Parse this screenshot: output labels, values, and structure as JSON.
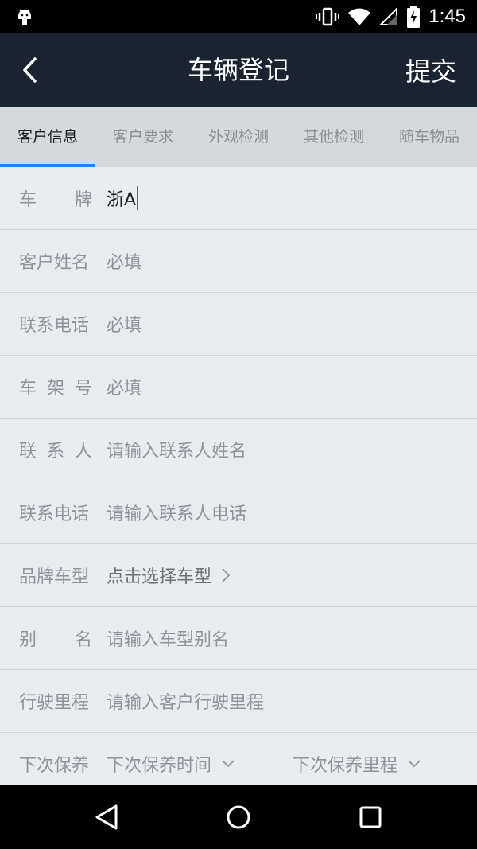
{
  "status_bar": {
    "time": "1:45",
    "icons": [
      "android-icon",
      "vibrate-icon",
      "wifi-icon",
      "signal-icon",
      "battery-charging-icon"
    ]
  },
  "app_bar": {
    "title": "车辆登记",
    "submit_label": "提交",
    "back_icon": "chevron-left-icon"
  },
  "tabs": [
    {
      "label": "客户信息",
      "active": true
    },
    {
      "label": "客户要求",
      "active": false
    },
    {
      "label": "外观检测",
      "active": false
    },
    {
      "label": "其他检测",
      "active": false
    },
    {
      "label": "随车物品",
      "active": false
    }
  ],
  "form": {
    "plate": {
      "label_chars": [
        "车",
        "牌"
      ],
      "value": "浙A"
    },
    "customer_name": {
      "label": "客户姓名",
      "placeholder": "必填"
    },
    "phone": {
      "label": "联系电话",
      "placeholder": "必填"
    },
    "vin": {
      "label_chars": [
        "车",
        "架",
        "号"
      ],
      "placeholder": "必填"
    },
    "contact": {
      "label_chars": [
        "联",
        "系",
        "人"
      ],
      "placeholder": "请输入联系人姓名"
    },
    "contact_phone": {
      "label": "联系电话",
      "placeholder": "请输入联系人电话"
    },
    "brand_model": {
      "label": "品牌车型",
      "value": "点击选择车型"
    },
    "alias": {
      "label_chars": [
        "别",
        "名"
      ],
      "placeholder": "请输入车型别名"
    },
    "mileage": {
      "label": "行驶里程",
      "placeholder": "请输入客户行驶里程"
    },
    "next_service": {
      "label": "下次保养",
      "time_placeholder": "下次保养时间",
      "mileage_placeholder": "下次保养里程"
    }
  },
  "colors": {
    "app_bar_bg": "#1b2331",
    "tab_indicator": "#2d7df6",
    "caret": "#00a088"
  },
  "nav_bar": {
    "icons": [
      "back-triangle-icon",
      "home-circle-icon",
      "recents-square-icon"
    ]
  }
}
